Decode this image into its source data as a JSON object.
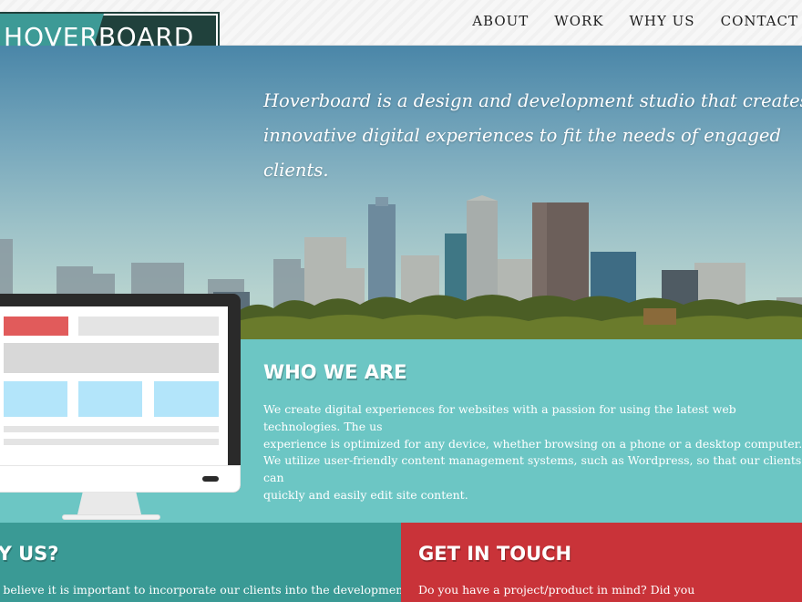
{
  "nav": {
    "logo_text": "HOVERBOARD",
    "links": [
      {
        "label": "ABOUT"
      },
      {
        "label": "WORK"
      },
      {
        "label": "WHY US"
      },
      {
        "label": "CONTACT"
      }
    ]
  },
  "hero": {
    "line1": "Hoverboard is a design and development studio that creates",
    "line2": "innovative digital experiences to fit the needs of engaged clients."
  },
  "who": {
    "title": "WHO WE ARE",
    "p1_line1": "We create digital experiences for websites with a passion for using the latest web technologies. The us",
    "p1_line2": "experience is optimized for any device, whether browsing on a phone or a desktop computer.",
    "p2_line1": "We utilize user-friendly content management systems, such as Wordpress, so that our clients can",
    "p2_line2": "quickly and easily edit site content."
  },
  "why": {
    "title": "HY US?",
    "text": "e believe it is important to incorporate our clients into the development"
  },
  "touch": {
    "title": "GET IN TOUCH",
    "text": "Do you have a project/product in mind? Did you"
  },
  "colors": {
    "teal_light": "#6cc6c4",
    "teal_dark": "#3a9a95",
    "red": "#c93339",
    "logo_dark": "#20413c",
    "mock_red": "#e15b5b",
    "mock_blue": "#b3e5fa"
  }
}
